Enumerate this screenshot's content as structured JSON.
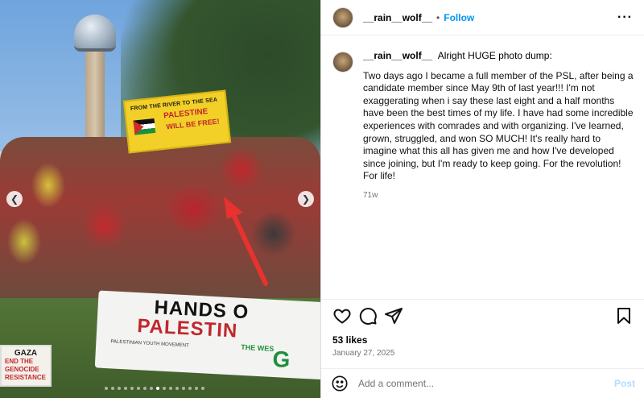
{
  "photo": {
    "top_banner": {
      "line1": "FROM THE RIVER TO THE SEA",
      "line2": "PALESTINE",
      "line3": "WILL BE FREE!"
    },
    "main_banner": {
      "line1": "HANDS O",
      "line2": "PALESTIN",
      "line3": "THE WES",
      "line4": "G",
      "org": "PALESTINIAN YOUTH MOVEMENT"
    },
    "sign": {
      "line1": "GAZA",
      "line2": "END THE",
      "line3": "GENOCIDE",
      "line4": "RESISTANCE"
    },
    "carousel": {
      "total": 16,
      "active_index": 8
    }
  },
  "post": {
    "header": {
      "username": "__rain__wolf__",
      "separator": "•",
      "follow_label": "Follow",
      "more_label": "···"
    },
    "caption": {
      "username": "__rain__wolf__",
      "intro": "Alright HUGE photo dump:",
      "body": "Two days ago I became a full member of the PSL, after being a candidate member since May 9th of last year!!! I'm not exaggerating when i say these last eight and a half months have been the best times of my life. I have had some incredible experiences with comrades and with organizing. I've learned, grown, struggled, and won SO MUCH! It's really hard to imagine what this all has given me and how I've developed since joining, but I'm ready to keep going. For the revolution! For life!",
      "time": "71w"
    },
    "likes": "53 likes",
    "date": "January 27, 2025",
    "comment": {
      "placeholder": "Add a comment...",
      "post_label": "Post"
    }
  },
  "colors": {
    "accent": "#0095f6",
    "post_disabled": "#b3dbff",
    "arrow": "#e8322f"
  }
}
